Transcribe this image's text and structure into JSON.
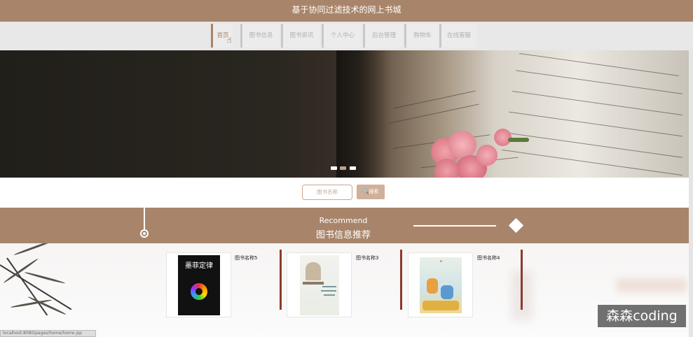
{
  "site_title": "基于协同过滤技术的网上书城",
  "nav": [
    {
      "label": "首页",
      "active": true
    },
    {
      "label": "图书信息",
      "active": false
    },
    {
      "label": "图书资讯",
      "active": false
    },
    {
      "label": "个人中心",
      "active": false
    },
    {
      "label": "后台管理",
      "active": false
    },
    {
      "label": "购物车",
      "active": false
    },
    {
      "label": "在线客服",
      "active": false
    }
  ],
  "carousel": {
    "dots": 3,
    "active_index": 1
  },
  "search": {
    "placeholder": "图书名称",
    "button_label": "搜索"
  },
  "recommend": {
    "title_en": "Recommend",
    "title_cn": "图书信息推荐"
  },
  "books": [
    {
      "name": "图书名称5",
      "cover_title": "墨菲定律"
    },
    {
      "name": "图书名称3",
      "cover_title": ""
    },
    {
      "name": "图书名称4",
      "cover_title": ""
    }
  ],
  "status_url": "localhost:8080/pages/home/home.jsp",
  "watermark": "森森coding",
  "colors": {
    "accent": "#a8856a",
    "card_separator": "#8c3a2e",
    "search_button": "#cfb09a"
  }
}
